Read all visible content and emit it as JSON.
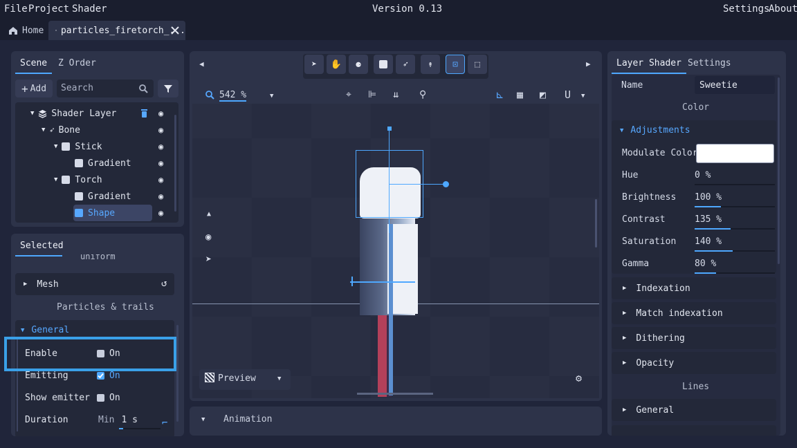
{
  "menu": {
    "file": "File",
    "project": "Project",
    "shader": "Shader",
    "version": "Version 0.13",
    "settings": "Settings",
    "about": "About"
  },
  "tabs": {
    "home": "Home",
    "file": "particles_firetorch_..."
  },
  "scene": {
    "tab_scene": "Scene",
    "tab_zorder": "Z Order",
    "add": "Add",
    "search_placeholder": "Search",
    "tree": [
      "Shader Layer",
      "Bone",
      "Stick",
      "Gradient",
      "Torch",
      "Gradient",
      "Shape"
    ]
  },
  "selected": {
    "tab": "Selected",
    "uniform": "uniform",
    "mesh": "Mesh",
    "particles_header": "Particles & trails",
    "general": "General",
    "enable_label": "Enable",
    "enable_value": "On",
    "emitting_label": "Emitting",
    "emitting_value": "On",
    "show_emitter_label": "Show emitter",
    "show_emitter_value": "On",
    "duration_label": "Duration",
    "duration_min": "Min",
    "duration_value": "1 s"
  },
  "viewport": {
    "zoom": "542 %",
    "preview": "Preview"
  },
  "animation": {
    "label": "Animation"
  },
  "layer_shader": {
    "tab_layer": "Layer Shader",
    "tab_settings": "Settings",
    "name_label": "Name",
    "name_value": "Sweetie",
    "color_header": "Color",
    "adjustments": "Adjustments",
    "modulate_label": "Modulate Color",
    "modulate_color": "#ffffff",
    "hue_label": "Hue",
    "hue_value": "0 %",
    "hue_level": 0,
    "brightness_label": "Brightness",
    "brightness_value": "100 %",
    "brightness_level": 0.33,
    "contrast_label": "Contrast",
    "contrast_value": "135 %",
    "contrast_level": 0.45,
    "saturation_label": "Saturation",
    "saturation_value": "140 %",
    "saturation_level": 0.47,
    "gamma_label": "Gamma",
    "gamma_value": "80 %",
    "gamma_level": 0.27,
    "indexation": "Indexation",
    "match_indexation": "Match indexation",
    "dithering": "Dithering",
    "opacity": "Opacity",
    "lines_header": "Lines",
    "lines_general": "General"
  },
  "colors": {
    "accent": "#4ea8ff",
    "highlight": "#3aa0e8"
  }
}
